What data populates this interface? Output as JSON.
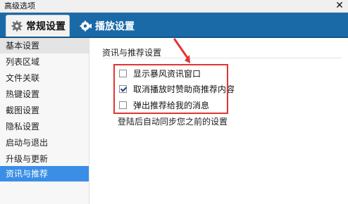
{
  "window": {
    "title": "高级选项",
    "close_label": "✕"
  },
  "tabs": [
    {
      "label": "常规设置",
      "icon": "gear-icon"
    },
    {
      "label": "播放设置",
      "icon": "play-settings-icon"
    }
  ],
  "sidebar": {
    "items": [
      {
        "label": "基本设置"
      },
      {
        "label": "列表区域"
      },
      {
        "label": "文件关联"
      },
      {
        "label": "热键设置"
      },
      {
        "label": "截图设置"
      },
      {
        "label": "隐私设置"
      },
      {
        "label": "启动与退出"
      },
      {
        "label": "升级与更新"
      },
      {
        "label": "资讯与推荐"
      }
    ],
    "hover_item": "基本设置",
    "selected_item": "资讯与推荐"
  },
  "section": {
    "title": "资讯与推荐设置",
    "options": [
      {
        "label": "显示暴风资讯窗口",
        "checked": false
      },
      {
        "label": "取消播放时赞助商推荐内容",
        "checked": true
      },
      {
        "label": "弹出推荐给我的消息",
        "checked": false
      }
    ],
    "footer_text": "登陆后自动同步您之前的设置"
  },
  "colors": {
    "tabbar": "#1a6aa8",
    "selected": "#3a8ee6",
    "highlight_box": "#e23434"
  }
}
